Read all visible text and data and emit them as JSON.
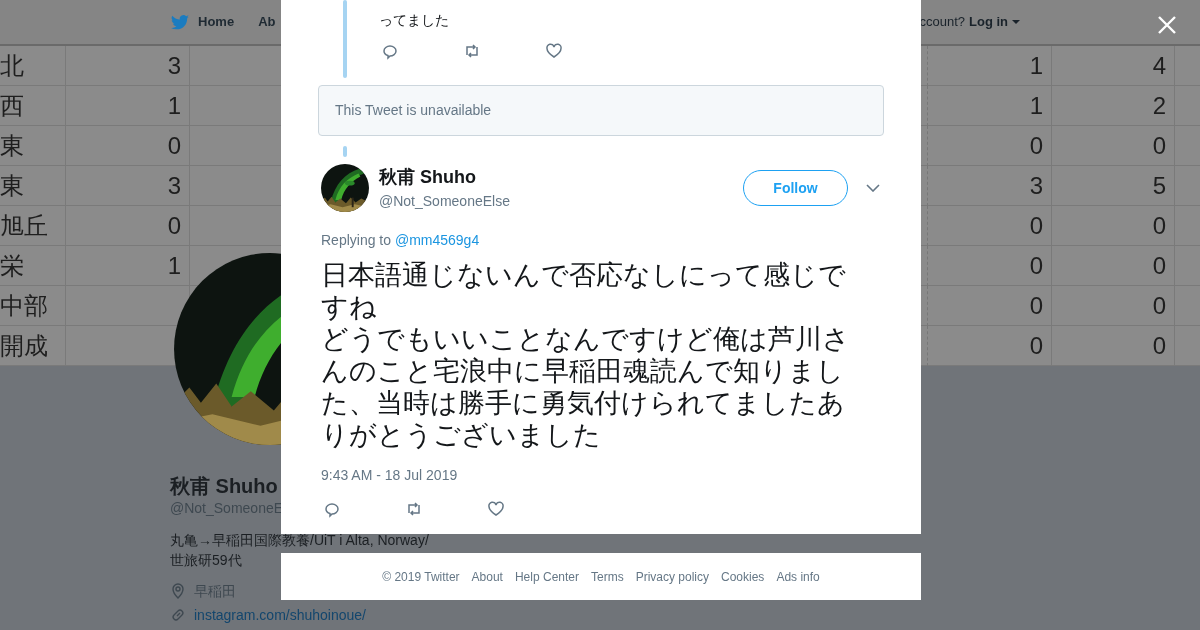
{
  "nav": {
    "items": [
      {
        "label": "Home",
        "kind": "logo"
      },
      {
        "label": "Ab",
        "kind": "plain"
      }
    ],
    "account_prompt": "ccount?",
    "login": "Log in"
  },
  "header_table": {
    "rows": [
      {
        "column_1": "北",
        "column_2": "3",
        "column_3": "1",
        "column_4": "4"
      },
      {
        "column_1": "西",
        "column_2": "1",
        "column_3": "1",
        "column_4": "2"
      },
      {
        "column_1": "東",
        "column_2": "0",
        "column_3": "0",
        "column_4": "0"
      },
      {
        "column_1": "東",
        "column_2": "3",
        "column_3": "3",
        "column_4": "5"
      },
      {
        "column_1": "旭丘",
        "column_2": "0",
        "column_3": "0",
        "column_4": "0"
      },
      {
        "column_1": "栄",
        "column_2": "1",
        "column_3": "0",
        "column_4": "0"
      },
      {
        "column_1": "中部",
        "column_3": "0",
        "column_4": "0"
      },
      {
        "column_1": "開成",
        "column_3": "0",
        "column_4": "0"
      }
    ]
  },
  "profile": {
    "name": "秋甫 Shuho",
    "handle": "@Not_SomeoneE",
    "bio": [
      "丸亀→早稲田国際教養/UiT i Alta, Norway/",
      "世旅研59代"
    ],
    "location": "早稲田",
    "link": "instagram.com/shuhoinoue/"
  },
  "modal": {
    "previous_tweet": {
      "text": "ってました"
    },
    "unavailable": "This Tweet is unavailable",
    "tweet": {
      "name": "秋甫 Shuho",
      "handle": "@Not_SomeoneElse",
      "follow": "Follow",
      "replying_label": "Replying to",
      "replying_to": "@mm4569g4",
      "paragraphs": [
        "日本語通じないんで否応なしにって感じですね",
        "どうでもいいことなんですけど俺は芦川さんのこと宅浪中に早稲田魂読んで知りました、当時は勝手に勇気付けられてましたありがとうございました"
      ],
      "time": "9:43 AM - 18 Jul 2019"
    }
  },
  "footer": [
    "© 2019 Twitter",
    "About",
    "Help Center",
    "Terms",
    "Privacy policy",
    "Cookies",
    "Ads info"
  ]
}
